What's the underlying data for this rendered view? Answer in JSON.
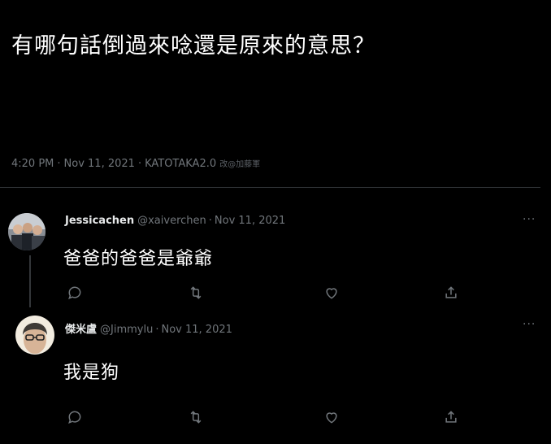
{
  "tweet": {
    "text": "有哪句話倒過來唸還是原來的意思？",
    "time": "4:20 PM",
    "date": "Nov 11, 2021",
    "source": "KATOTAKA2.0",
    "watermark": "改@加藤軍"
  },
  "replies": [
    {
      "name": "Jessicachen",
      "handle": "@xaiverchen",
      "date": "Nov 11, 2021",
      "text": "爸爸的爸爸是爺爺"
    },
    {
      "name": "傑米盧",
      "handle": "@Jimmylu",
      "date": "Nov 11, 2021",
      "text": "我是狗"
    }
  ],
  "separator": "·",
  "more_label": "···",
  "icons": {
    "reply": "reply-icon",
    "retweet": "retweet-icon",
    "like": "heart-icon",
    "share": "share-icon",
    "more": "more-icon"
  },
  "colors": {
    "background": "#000000",
    "text": "#e7e9ea",
    "muted": "#71767b",
    "divider": "#2f3336"
  }
}
